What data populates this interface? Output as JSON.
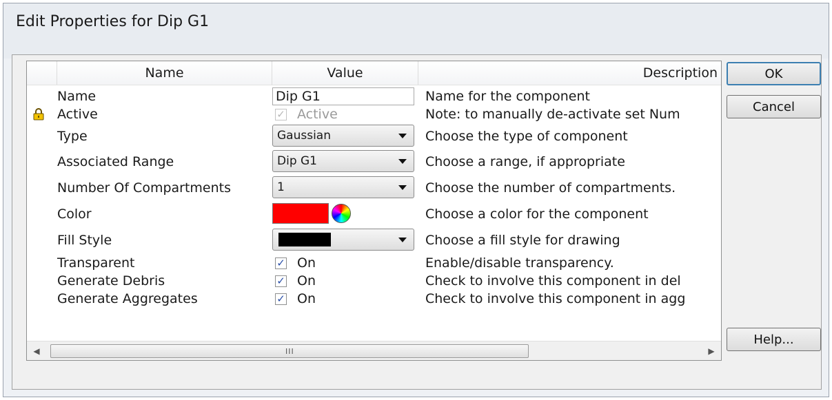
{
  "window": {
    "title": "Edit Properties for Dip G1"
  },
  "grid": {
    "headers": {
      "name": "Name",
      "value": "Value",
      "description": "Description"
    },
    "rows": [
      {
        "name": "Name",
        "value": "Dip G1",
        "description": "Name for the component"
      },
      {
        "name": "Active",
        "value": "Active",
        "description": "Note: to manually de-activate set Num"
      },
      {
        "name": "Type",
        "value": "Gaussian",
        "description": "Choose the type of component"
      },
      {
        "name": "Associated Range",
        "value": "Dip G1",
        "description": "Choose a range, if appropriate"
      },
      {
        "name": "Number Of Compartments",
        "value": "1",
        "description": "Choose the number of compartments."
      },
      {
        "name": "Color",
        "value": "#ff0000",
        "description": "Choose a color for the component"
      },
      {
        "name": "Fill Style",
        "value": "",
        "description": "Choose a fill style for drawing"
      },
      {
        "name": "Transparent",
        "value": "On",
        "description": "Enable/disable transparency."
      },
      {
        "name": "Generate Debris",
        "value": "On",
        "description": "Check to involve this component in del"
      },
      {
        "name": "Generate Aggregates",
        "value": "On",
        "description": "Check to involve this component in agg"
      }
    ],
    "scrollbar_grip": "III"
  },
  "buttons": {
    "ok": "OK",
    "cancel": "Cancel",
    "help": "Help..."
  },
  "icons": {
    "lock": "lock-icon",
    "check": "✓"
  }
}
